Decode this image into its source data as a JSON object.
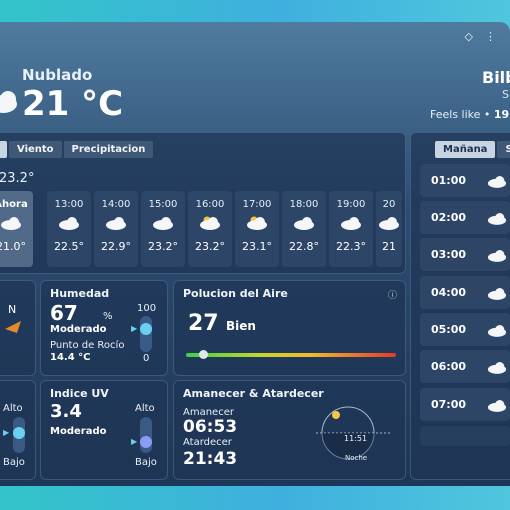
{
  "header": {
    "condition": "Nublado",
    "temperature": "21 °C",
    "city": "Bilb",
    "city_sub": "S",
    "feels_like_label": "Feels like •",
    "feels_like_value": "19."
  },
  "hourly": {
    "tabs": [
      "",
      "Viento",
      "Precipitacion"
    ],
    "max_temp": "23.2°",
    "hours": [
      {
        "time": "Ahora",
        "temp": "21.0°"
      },
      {
        "time": "13:00",
        "temp": "22.5°"
      },
      {
        "time": "14:00",
        "temp": "22.9°"
      },
      {
        "time": "15:00",
        "temp": "23.2°"
      },
      {
        "time": "16:00",
        "temp": "23.2°"
      },
      {
        "time": "17:00",
        "temp": "23.1°"
      },
      {
        "time": "18:00",
        "temp": "22.8°"
      },
      {
        "time": "19:00",
        "temp": "22.3°"
      },
      {
        "time": "20",
        "temp": "21"
      }
    ]
  },
  "wind": {
    "direction": "N"
  },
  "humidity": {
    "title": "Humedad",
    "value": "67",
    "unit": "%",
    "level": "Moderado",
    "dew_label": "Punto de Rocío",
    "dew_value": "14.4 °C",
    "scale_max": "100",
    "scale_min": "0"
  },
  "air": {
    "title": "Polucion del Aire",
    "value": "27",
    "quality": "Bien",
    "info_icon": "info-icon"
  },
  "leftbottom": {
    "top": "Alto",
    "bottom": "Bajo"
  },
  "uv": {
    "title": "Indice UV",
    "value": "3.4",
    "level": "Moderado",
    "top": "Alto",
    "bottom": "Bajo"
  },
  "sun": {
    "title": "Amanecer & Atardecer",
    "sunrise_label": "Amanecer",
    "sunrise": "06:53",
    "sunset_label": "Atardecer",
    "sunset": "21:43",
    "noon": "11:51",
    "night": "Noche"
  },
  "daily": {
    "tabs": [
      "Mañana",
      "S"
    ],
    "rows": [
      "01:00",
      "02:00",
      "03:00",
      "04:00",
      "05:00",
      "06:00",
      "07:00"
    ]
  },
  "colors": {
    "accent": "#6ad0f0",
    "uv_knob": "#8a9cf4"
  }
}
